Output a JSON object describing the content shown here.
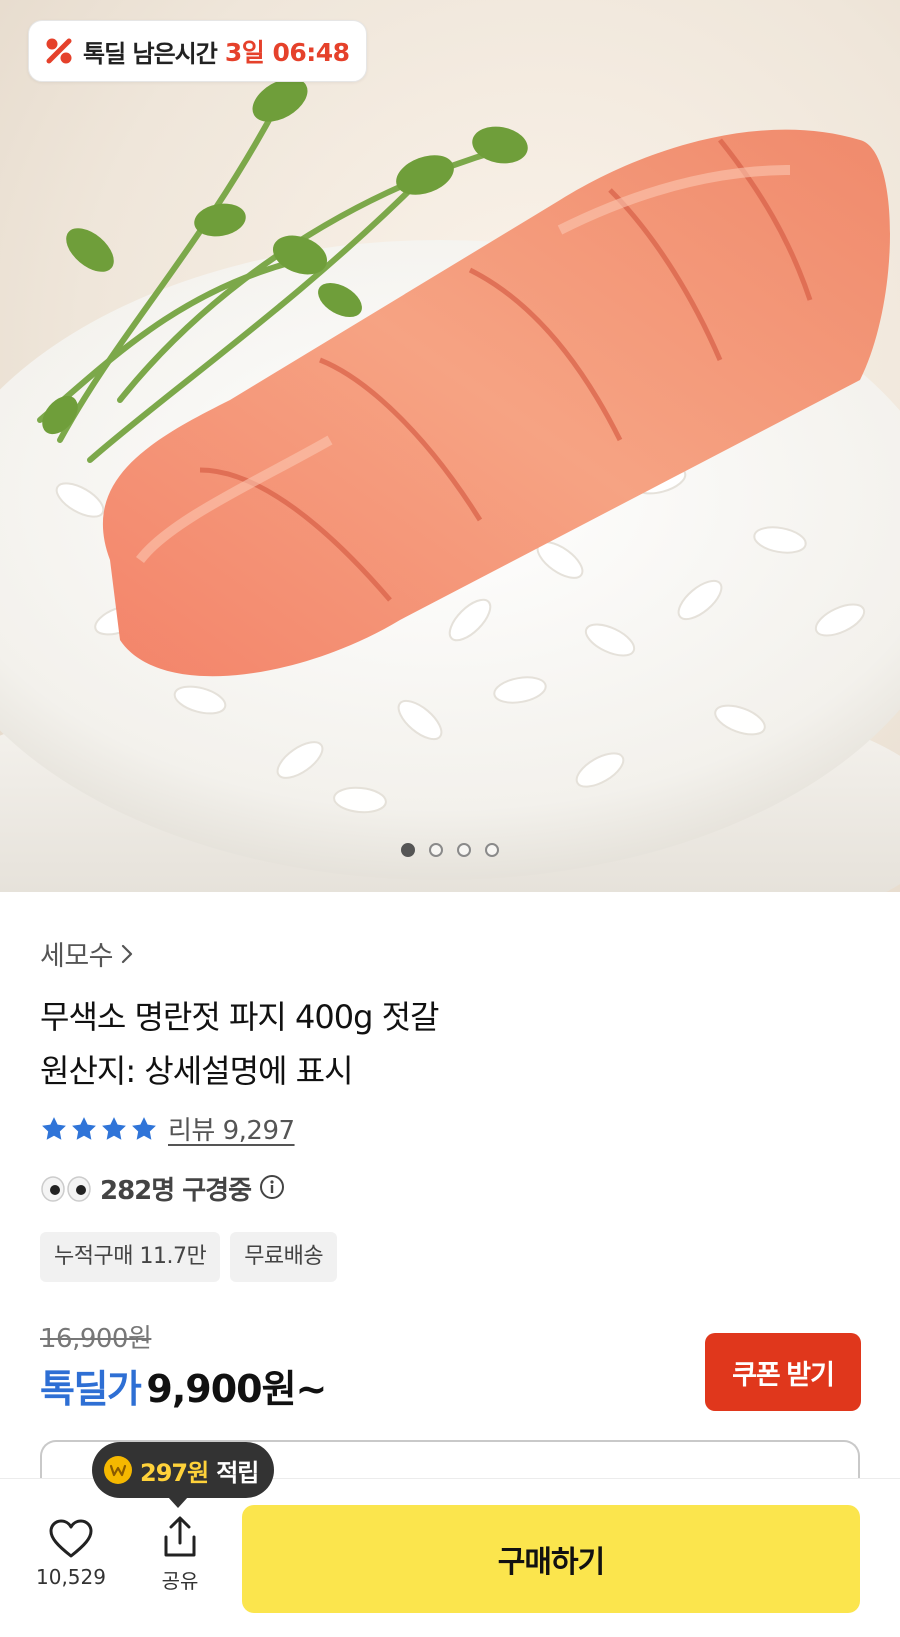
{
  "timer": {
    "label": "톡딜 남은시간",
    "value": "3일 06:48"
  },
  "hero": {
    "pages": 4,
    "active_page": 1
  },
  "product": {
    "brand": "세모수",
    "title_line1": "무색소 명란젓 파지 400g 젓갈",
    "title_line2": "원산지: 상세설명에 표시",
    "rating_stars": 4,
    "review_text": "리뷰 9,297",
    "viewers_text": "282명 구경중",
    "tags": [
      "누적구매 11.7만",
      "무료배송"
    ],
    "original_price": "16,900원",
    "deal_label": "톡딜가",
    "deal_price": "9,900원~"
  },
  "coupon_button": "쿠폰 받기",
  "reward_tooltip": {
    "amount": "297원",
    "text": "적립"
  },
  "bottom_bar": {
    "like_count": "10,529",
    "share_label": "공유",
    "buy_label": "구매하기"
  },
  "colors": {
    "accent_red": "#e0371c",
    "deal_blue": "#2e6fd4",
    "buy_yellow": "#fbe54d",
    "star_blue": "#2f74d8"
  }
}
